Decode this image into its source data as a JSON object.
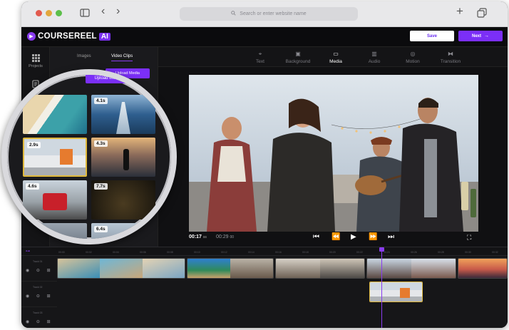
{
  "browser": {
    "url_placeholder": "Search or enter website name",
    "icons": [
      "sidebar-toggle-icon",
      "back-icon",
      "forward-icon",
      "search-icon",
      "new-tab-icon",
      "tabs-icon"
    ]
  },
  "app": {
    "logo_text": "COURSEREEL",
    "logo_badge": "AI",
    "save_label": "Save",
    "next_label": "Next",
    "accent_color": "#7b2ff7"
  },
  "rail": {
    "items": [
      {
        "label": "Projects",
        "icon": "grid-icon"
      },
      {
        "label": "",
        "icon": "document-icon"
      }
    ]
  },
  "panel": {
    "tabs": [
      "Images",
      "Video Clips"
    ],
    "active_tab": "Video Clips",
    "upload_label": "Upload Media",
    "clips": [
      {
        "duration": "",
        "theme": "beach-aerial"
      },
      {
        "duration": "4.1s",
        "theme": "boat-wake"
      },
      {
        "duration": "2.9s",
        "theme": "shipping-container",
        "selected": true
      },
      {
        "duration": "4.3s",
        "theme": "sunset-silhouette"
      },
      {
        "duration": "4.6s",
        "theme": "red-tractor"
      },
      {
        "duration": "7.7s",
        "theme": "dark-bokeh"
      },
      {
        "duration": "",
        "theme": "partial"
      },
      {
        "duration": "6.4s",
        "theme": "partial"
      }
    ]
  },
  "tools": [
    {
      "label": "Text",
      "icon": "text-icon"
    },
    {
      "label": "Background",
      "icon": "background-icon"
    },
    {
      "label": "Media",
      "icon": "media-icon",
      "active": true
    },
    {
      "label": "Audio",
      "icon": "audio-icon"
    },
    {
      "label": "Motion",
      "icon": "motion-icon"
    },
    {
      "label": "Transition",
      "icon": "transition-icon"
    }
  ],
  "player": {
    "current_time": "00:17",
    "current_time_unit": "ss",
    "total_time": "00:29",
    "total_time_unit": "00"
  },
  "timeline": {
    "ruler_labels": [
      "00:00",
      "00:02",
      "00:04",
      "00:06",
      "00:08",
      "00:10",
      "00:12",
      "00:14",
      "00:16",
      "00:18",
      "00:20",
      "00:22",
      "00:24",
      "00:26",
      "00:28",
      "00:30",
      "00:32"
    ],
    "tracks": [
      {
        "name": "Track 01"
      },
      {
        "name": "Track 02"
      },
      {
        "name": "Track 03"
      }
    ]
  }
}
